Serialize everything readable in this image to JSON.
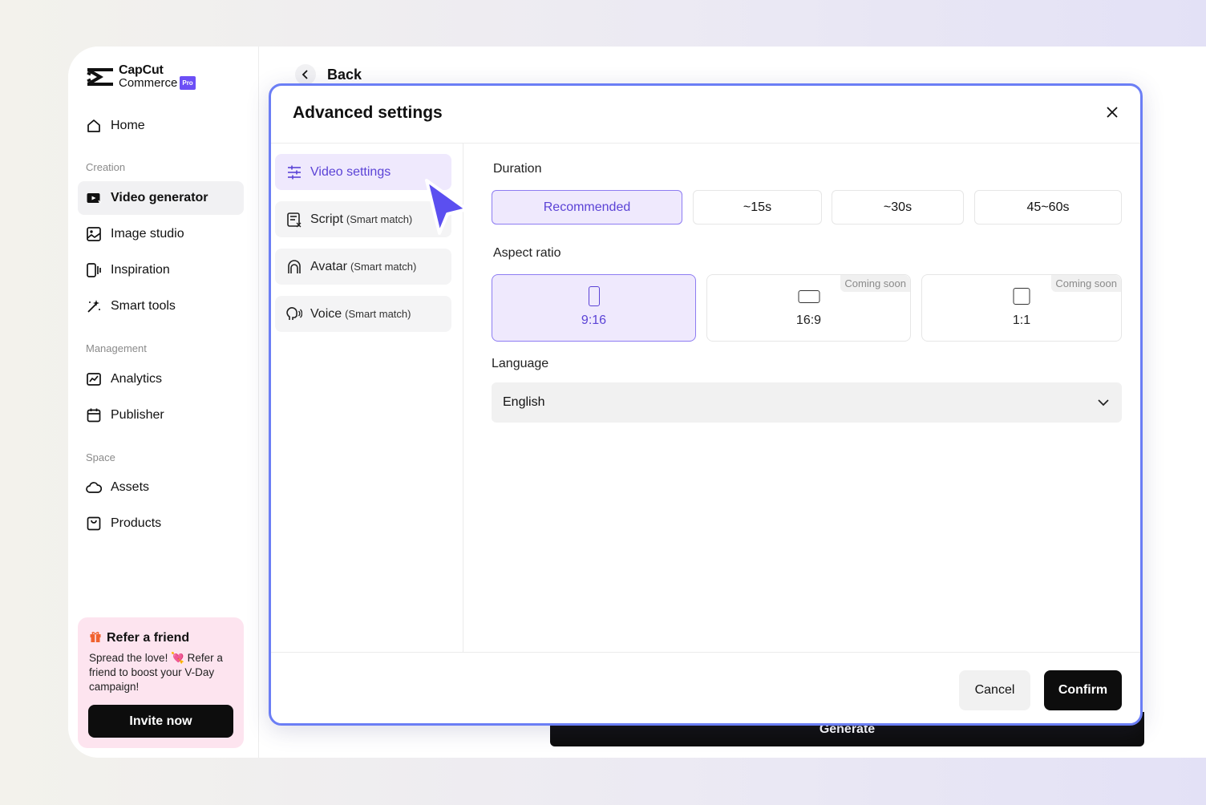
{
  "brand": {
    "name_line1": "CapCut",
    "name_line2": "Commerce",
    "badge": "Pro"
  },
  "sidebar": {
    "home": "Home",
    "sections": {
      "creation": "Creation",
      "management": "Management",
      "space": "Space"
    },
    "items": {
      "video_generator": "Video generator",
      "image_studio": "Image studio",
      "inspiration": "Inspiration",
      "smart_tools": "Smart tools",
      "analytics": "Analytics",
      "publisher": "Publisher",
      "assets": "Assets",
      "products": "Products"
    },
    "refer": {
      "title": "Refer a friend",
      "text_before": "Spread the love! ",
      "heart": "💘",
      "text_after": " Refer a friend to boost your V-Day campaign!",
      "button": "Invite now"
    }
  },
  "header": {
    "back_label": "Back"
  },
  "generate_label": "Generate",
  "modal": {
    "title": "Advanced settings",
    "tabs": [
      {
        "label": "Video settings",
        "suffix": ""
      },
      {
        "label": "Script",
        "suffix": "(Smart match)"
      },
      {
        "label": "Avatar",
        "suffix": "(Smart match)"
      },
      {
        "label": "Voice",
        "suffix": "(Smart match)"
      }
    ],
    "duration": {
      "label": "Duration",
      "options": [
        "Recommended",
        "~15s",
        "~30s",
        "45~60s"
      ],
      "selected": "Recommended"
    },
    "aspect_ratio": {
      "label": "Aspect ratio",
      "options": [
        {
          "label": "9:16",
          "badge": ""
        },
        {
          "label": "16:9",
          "badge": "Coming soon"
        },
        {
          "label": "1:1",
          "badge": "Coming soon"
        }
      ],
      "selected": "9:16"
    },
    "language": {
      "label": "Language",
      "value": "English"
    },
    "cancel": "Cancel",
    "confirm": "Confirm"
  },
  "colors": {
    "accent": "#5b43d6",
    "accent_bg": "#efe9fd",
    "modal_border": "#6b7ef5",
    "cursor": "#5b4ff0"
  }
}
